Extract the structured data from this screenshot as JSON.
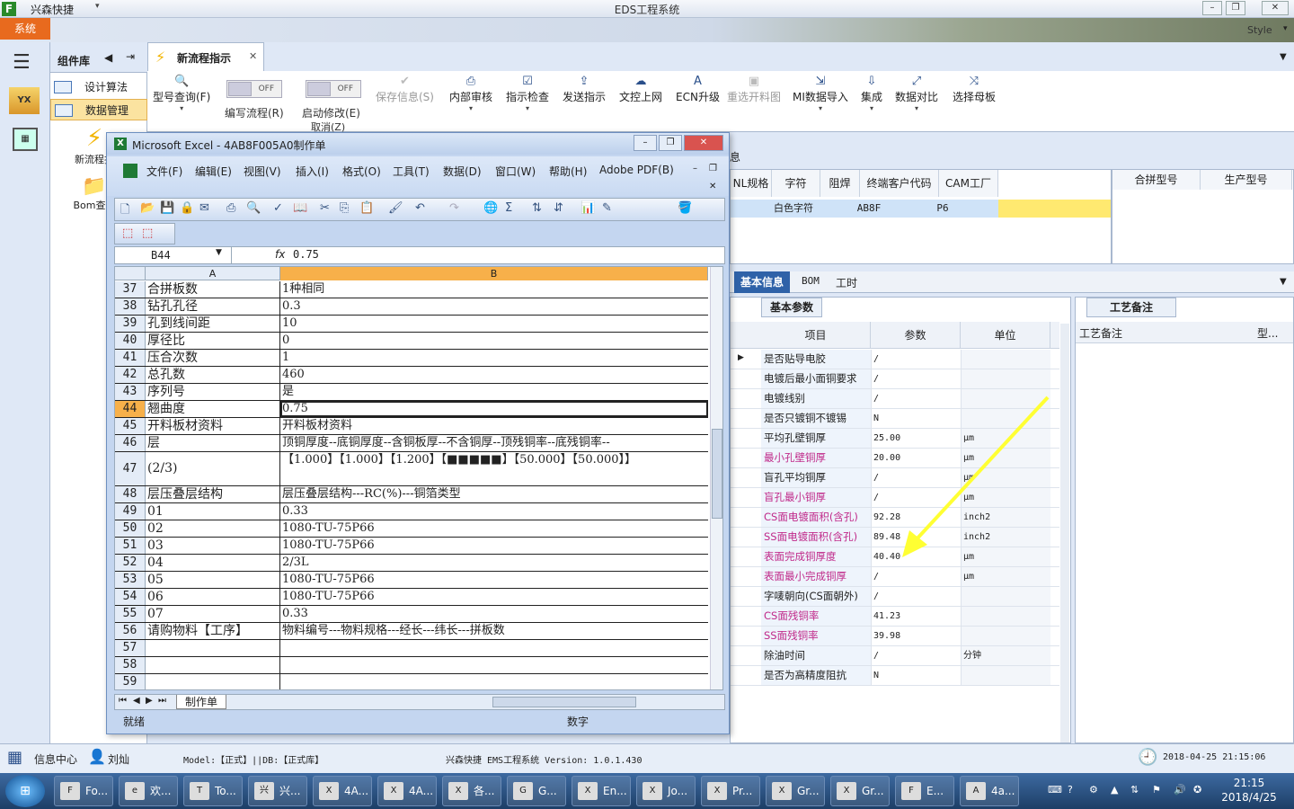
{
  "window": {
    "app_short": "兴森快捷",
    "title": "EDS工程系统",
    "style_label": "Style",
    "system_menu": "系统"
  },
  "leftnav": {
    "yx_label": "YX"
  },
  "components": {
    "title": "组件库",
    "items": [
      {
        "label": "设计算法"
      },
      {
        "label": "数据管理"
      }
    ],
    "tiles": [
      {
        "label": "新流程指"
      },
      {
        "label": "Bom查询"
      }
    ]
  },
  "doc_tab": {
    "label": "新流程指示"
  },
  "ribbon": {
    "type_query": "型号查询(F)",
    "edit_flow": "编写流程(R)",
    "toggle_off": "OFF",
    "start_modify": "启动修改(E)",
    "cancel": "取消(Z)",
    "save_info": "保存信息(S)",
    "internal_review": "内部审核",
    "check_instructions": "指示检查",
    "send_instructions": "发送指示",
    "upload": "文控上网",
    "ecn_upgrade": "ECN升级",
    "reselect_drawing": "重选开料图",
    "mi_import": "MI数据导入",
    "integrate": "集成",
    "compare": "数据对比",
    "select_master": "选择母板"
  },
  "top_grid": {
    "section_label": "息",
    "headers": [
      "NL规格",
      "字符",
      "阻焊",
      "终端客户代码",
      "CAM工厂"
    ],
    "row": [
      "白色字符",
      "AB8F",
      "P6"
    ],
    "right_headers": [
      "合拼型号",
      "生产型号"
    ]
  },
  "info_tabs": [
    {
      "label": "基本信息"
    },
    {
      "label": "BOM"
    },
    {
      "label": "工时"
    }
  ],
  "params": {
    "tab_label": "基本参数",
    "headers": [
      "项目",
      "参数",
      "单位"
    ],
    "rows": [
      {
        "name": "是否贴导电胶",
        "value": "/",
        "unit": "",
        "highlight": false
      },
      {
        "name": "电镀后最小面铜要求",
        "value": "/",
        "unit": "",
        "highlight": false
      },
      {
        "name": "电镀线别",
        "value": "/",
        "unit": "",
        "highlight": false
      },
      {
        "name": "是否只镀铜不镀锡",
        "value": "N",
        "unit": "",
        "highlight": false
      },
      {
        "name": "平均孔壁铜厚",
        "value": "25.00",
        "unit": "μm",
        "highlight": false
      },
      {
        "name": "最小孔壁铜厚",
        "value": "20.00",
        "unit": "μm",
        "highlight": true
      },
      {
        "name": "盲孔平均铜厚",
        "value": "/",
        "unit": "μm",
        "highlight": false
      },
      {
        "name": "盲孔最小铜厚",
        "value": "/",
        "unit": "μm",
        "highlight": true
      },
      {
        "name": "CS面电镀面积(含孔)",
        "value": "92.28",
        "unit": "inch2",
        "highlight": true
      },
      {
        "name": "SS面电镀面积(含孔)",
        "value": "89.48",
        "unit": "inch2",
        "highlight": true
      },
      {
        "name": "表面完成铜厚度",
        "value": "40.40",
        "unit": "μm",
        "highlight": true
      },
      {
        "name": "表面最小完成铜厚",
        "value": "/",
        "unit": "μm",
        "highlight": true
      },
      {
        "name": "字唛朝向(CS面朝外)",
        "value": "/",
        "unit": "",
        "highlight": false
      },
      {
        "name": "CS面残铜率",
        "value": "41.23",
        "unit": "",
        "highlight": true
      },
      {
        "name": "SS面残铜率",
        "value": "39.98",
        "unit": "",
        "highlight": true
      },
      {
        "name": "除油时间",
        "value": "/",
        "unit": "分钟",
        "highlight": false
      },
      {
        "name": "是否为高精度阻抗",
        "value": "N",
        "unit": "",
        "highlight": false
      }
    ]
  },
  "notes": {
    "tab_label": "工艺备注",
    "header": "工艺备注",
    "header_right": "型..."
  },
  "excel": {
    "title": "Microsoft Excel - 4AB8F005A0制作单",
    "menus": [
      "文件(F)",
      "编辑(E)",
      "视图(V)",
      "插入(I)",
      "格式(O)",
      "工具(T)",
      "数据(D)",
      "窗口(W)",
      "帮助(H)",
      "Adobe PDF(B)"
    ],
    "namebox": "B44",
    "fx": "fx",
    "formula": "0.75",
    "col_a": "A",
    "col_b": "B",
    "selected_row": "44",
    "rows": [
      {
        "n": "37",
        "a": "合拼板数",
        "b": "1种相同"
      },
      {
        "n": "38",
        "a": "钻孔孔径",
        "b": "0.3"
      },
      {
        "n": "39",
        "a": "孔到线间距",
        "b": "10"
      },
      {
        "n": "40",
        "a": "厚径比",
        "b": "0"
      },
      {
        "n": "41",
        "a": "压合次数",
        "b": "1"
      },
      {
        "n": "42",
        "a": "总孔数",
        "b": "460"
      },
      {
        "n": "43",
        "a": "序列号",
        "b": "是"
      },
      {
        "n": "44",
        "a": "翘曲度",
        "b": "0.75"
      },
      {
        "n": "45",
        "a": "开料板材资料",
        "b": "开料板材资料"
      },
      {
        "n": "46",
        "a": "层",
        "b": "顶铜厚度--底铜厚度--含铜板厚--不含铜厚--顶残铜率--底残铜率--"
      },
      {
        "n": "47",
        "a": "(2/3)",
        "b": "【1.000】【1.000】【1.200】【■■■■■】【50.000】【50.000】】",
        "tall": true
      },
      {
        "n": "48",
        "a": "层压叠层结构",
        "b": "层压叠层结构---RC(%)---铜箔类型"
      },
      {
        "n": "49",
        "a": "01",
        "b": "0.33"
      },
      {
        "n": "50",
        "a": "02",
        "b": "1080-TU-75P66"
      },
      {
        "n": "51",
        "a": "03",
        "b": "1080-TU-75P66"
      },
      {
        "n": "52",
        "a": "04",
        "b": "2/3L"
      },
      {
        "n": "53",
        "a": "05",
        "b": "1080-TU-75P66"
      },
      {
        "n": "54",
        "a": "06",
        "b": "1080-TU-75P66"
      },
      {
        "n": "55",
        "a": "07",
        "b": "0.33"
      },
      {
        "n": "56",
        "a": "请购物料【工序】",
        "b": "物料编号---物料规格---经长---纬长---拼板数"
      },
      {
        "n": "57",
        "a": "",
        "b": ""
      },
      {
        "n": "58",
        "a": "",
        "b": ""
      },
      {
        "n": "59",
        "a": "",
        "b": ""
      }
    ],
    "sheet_tab": "制作单",
    "status_ready": "就绪",
    "status_num": "数字"
  },
  "statusbar": {
    "info_center": "信息中心",
    "user": "刘灿",
    "model": "Model:【正式】||DB:【正式库】",
    "version": "兴森快捷 EMS工程系统 Version: 1.0.1.430",
    "datetime": "2018-04-25 21:15:06"
  },
  "taskbar": {
    "items": [
      {
        "label": "Fo...",
        "icon": "F"
      },
      {
        "label": "欢...",
        "icon": "e"
      },
      {
        "label": "To...",
        "icon": "T"
      },
      {
        "label": "兴...",
        "icon": "兴"
      },
      {
        "label": "4A...",
        "icon": "X"
      },
      {
        "label": "4A...",
        "icon": "X"
      },
      {
        "label": "各...",
        "icon": "X"
      },
      {
        "label": "G...",
        "icon": "G"
      },
      {
        "label": "En...",
        "icon": "X"
      },
      {
        "label": "Jo...",
        "icon": "X"
      },
      {
        "label": "Pr...",
        "icon": "X"
      },
      {
        "label": "Gr...",
        "icon": "X"
      },
      {
        "label": "Gr...",
        "icon": "X"
      },
      {
        "label": "E...",
        "icon": "F"
      },
      {
        "label": "4a...",
        "icon": "A"
      }
    ],
    "time": "21:15",
    "date": "2018/4/25"
  },
  "colors": {
    "accent": "#2f62a8",
    "system_menu": "#e86a1e",
    "selected_header": "#f7b04a",
    "highlight_text": "#c02a8a",
    "annotation_arrow": "#ffff33"
  }
}
